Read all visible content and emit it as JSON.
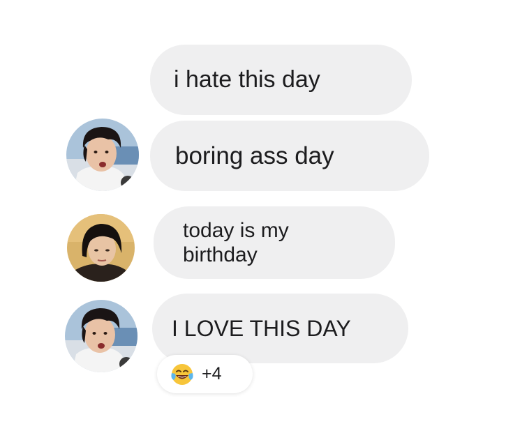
{
  "messages": [
    {
      "text": "i hate this day",
      "has_avatar": false
    },
    {
      "text": "boring ass day",
      "has_avatar": true,
      "avatar_icon": "user-avatar-dark-hair-white-shirt"
    },
    {
      "text": "today is my birthday",
      "has_avatar": true,
      "avatar_icon": "user-avatar-dark-hair-brown-background"
    },
    {
      "text": "I LOVE THIS DAY",
      "has_avatar": true,
      "avatar_icon": "user-avatar-dark-hair-white-shirt"
    }
  ],
  "reaction": {
    "emoji_icon": "face-with-tears-of-joy-icon",
    "count": "+4"
  },
  "colors": {
    "bubble": "#efeff0",
    "text": "#1c1c1e",
    "background": "#ffffff"
  }
}
